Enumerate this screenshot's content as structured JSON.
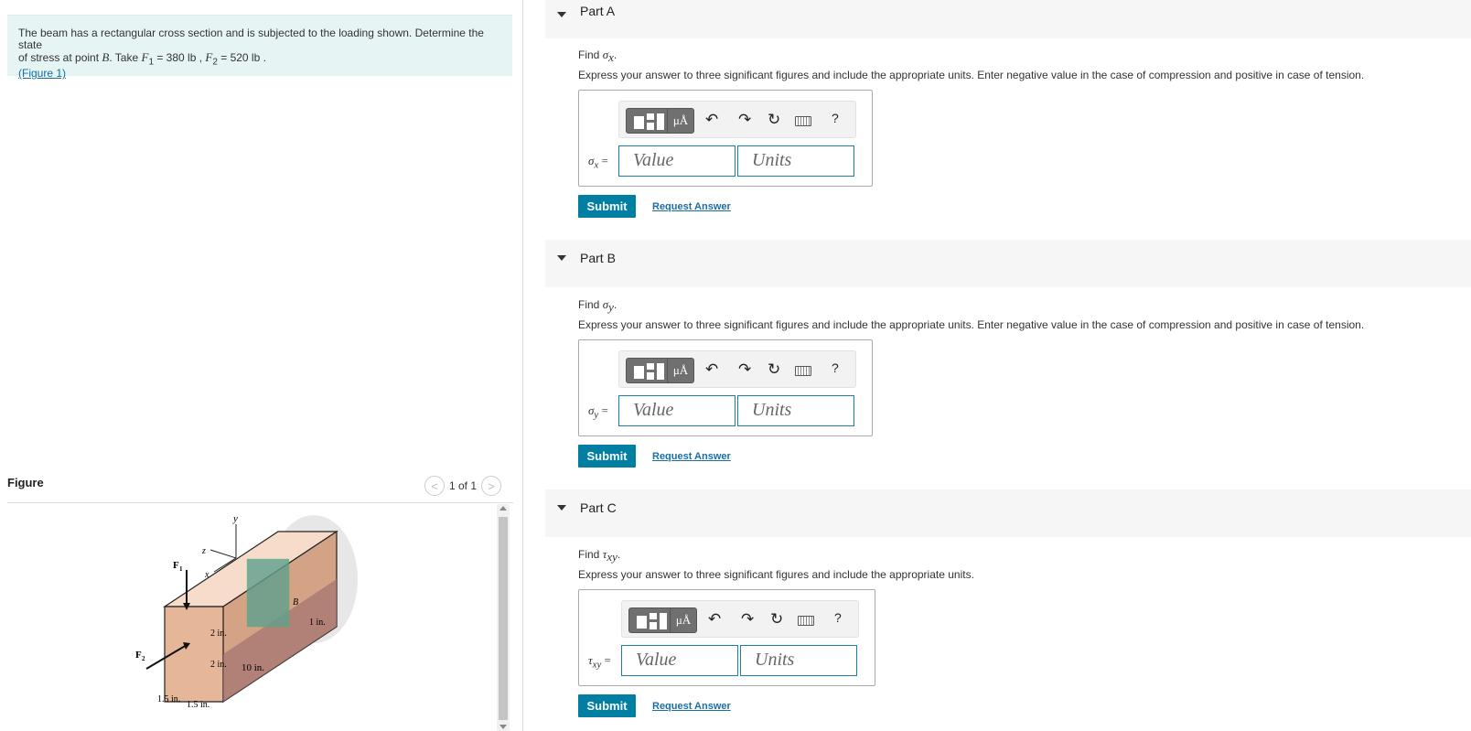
{
  "problem": {
    "line1": "The beam has a rectangular cross section and is subjected to the loading shown. Determine the state",
    "line2_prefix": "of stress at point ",
    "point": "B",
    "take": ". Take ",
    "f1_label": "F",
    "f1_sub": "1",
    "f1_value": " = 380  lb , ",
    "f2_label": "F",
    "f2_sub": "2",
    "f2_value": " = 520  lb .",
    "figure_link": "(Figure 1)"
  },
  "figure": {
    "heading": "Figure",
    "pager": "1 of 1",
    "prev": "<",
    "next": ">",
    "labels": {
      "y": "y",
      "z": "z",
      "x": "x",
      "f1": "F",
      "f1s": "1",
      "f2": "F",
      "f2s": "2",
      "b": "B",
      "dim_2in_a": "2 in.",
      "dim_2in_b": "2 in.",
      "dim_1in": "1 in.",
      "dim_10in": "10 in.",
      "dim_15a": "1.5 in.",
      "dim_15b": "1.5 in."
    }
  },
  "parts": [
    {
      "title": "Part A",
      "find_prefix": "Find ",
      "find_sym": "σ",
      "find_sub": "x",
      "find_suffix": ".",
      "instructions": "Express your answer to three significant figures and include the appropriate units. Enter negative value in the case of compression and positive in case of tension.",
      "var_sym": "σ",
      "var_sub": "x",
      "var_eq": " =",
      "value_placeholder": "Value",
      "units_placeholder": "Units",
      "submit": "Submit",
      "request": "Request Answer"
    },
    {
      "title": "Part B",
      "find_prefix": "Find ",
      "find_sym": "σ",
      "find_sub": "y",
      "find_suffix": ".",
      "instructions": "Express your answer to three significant figures and include the appropriate units. Enter negative value in the case of compression and positive in case of tension.",
      "var_sym": "σ",
      "var_sub": "y",
      "var_eq": " =",
      "value_placeholder": "Value",
      "units_placeholder": "Units",
      "submit": "Submit",
      "request": "Request Answer"
    },
    {
      "title": "Part C",
      "find_prefix": "Find ",
      "find_sym": "τ",
      "find_sub": "xy",
      "find_suffix": ".",
      "instructions": "Express your answer to three significant figures and include the appropriate units.",
      "var_sym": "τ",
      "var_sub": "xy",
      "var_eq": " =",
      "value_placeholder": "Value",
      "units_placeholder": "Units",
      "submit": "Submit",
      "request": "Request Answer"
    }
  ],
  "toolbar": {
    "mu": "μÅ",
    "undo": "↶",
    "redo": "↷",
    "reset": "↻",
    "help": "?",
    "icons": [
      "templates-icon",
      "units-mu-icon",
      "undo-icon",
      "redo-icon",
      "reset-icon",
      "keyboard-icon",
      "help-icon"
    ]
  },
  "colors": {
    "problem_bg": "#e6f4f4",
    "submit_bg": "#007fa3",
    "input_border": "#1a7db0",
    "link": "#1a6ea8"
  }
}
